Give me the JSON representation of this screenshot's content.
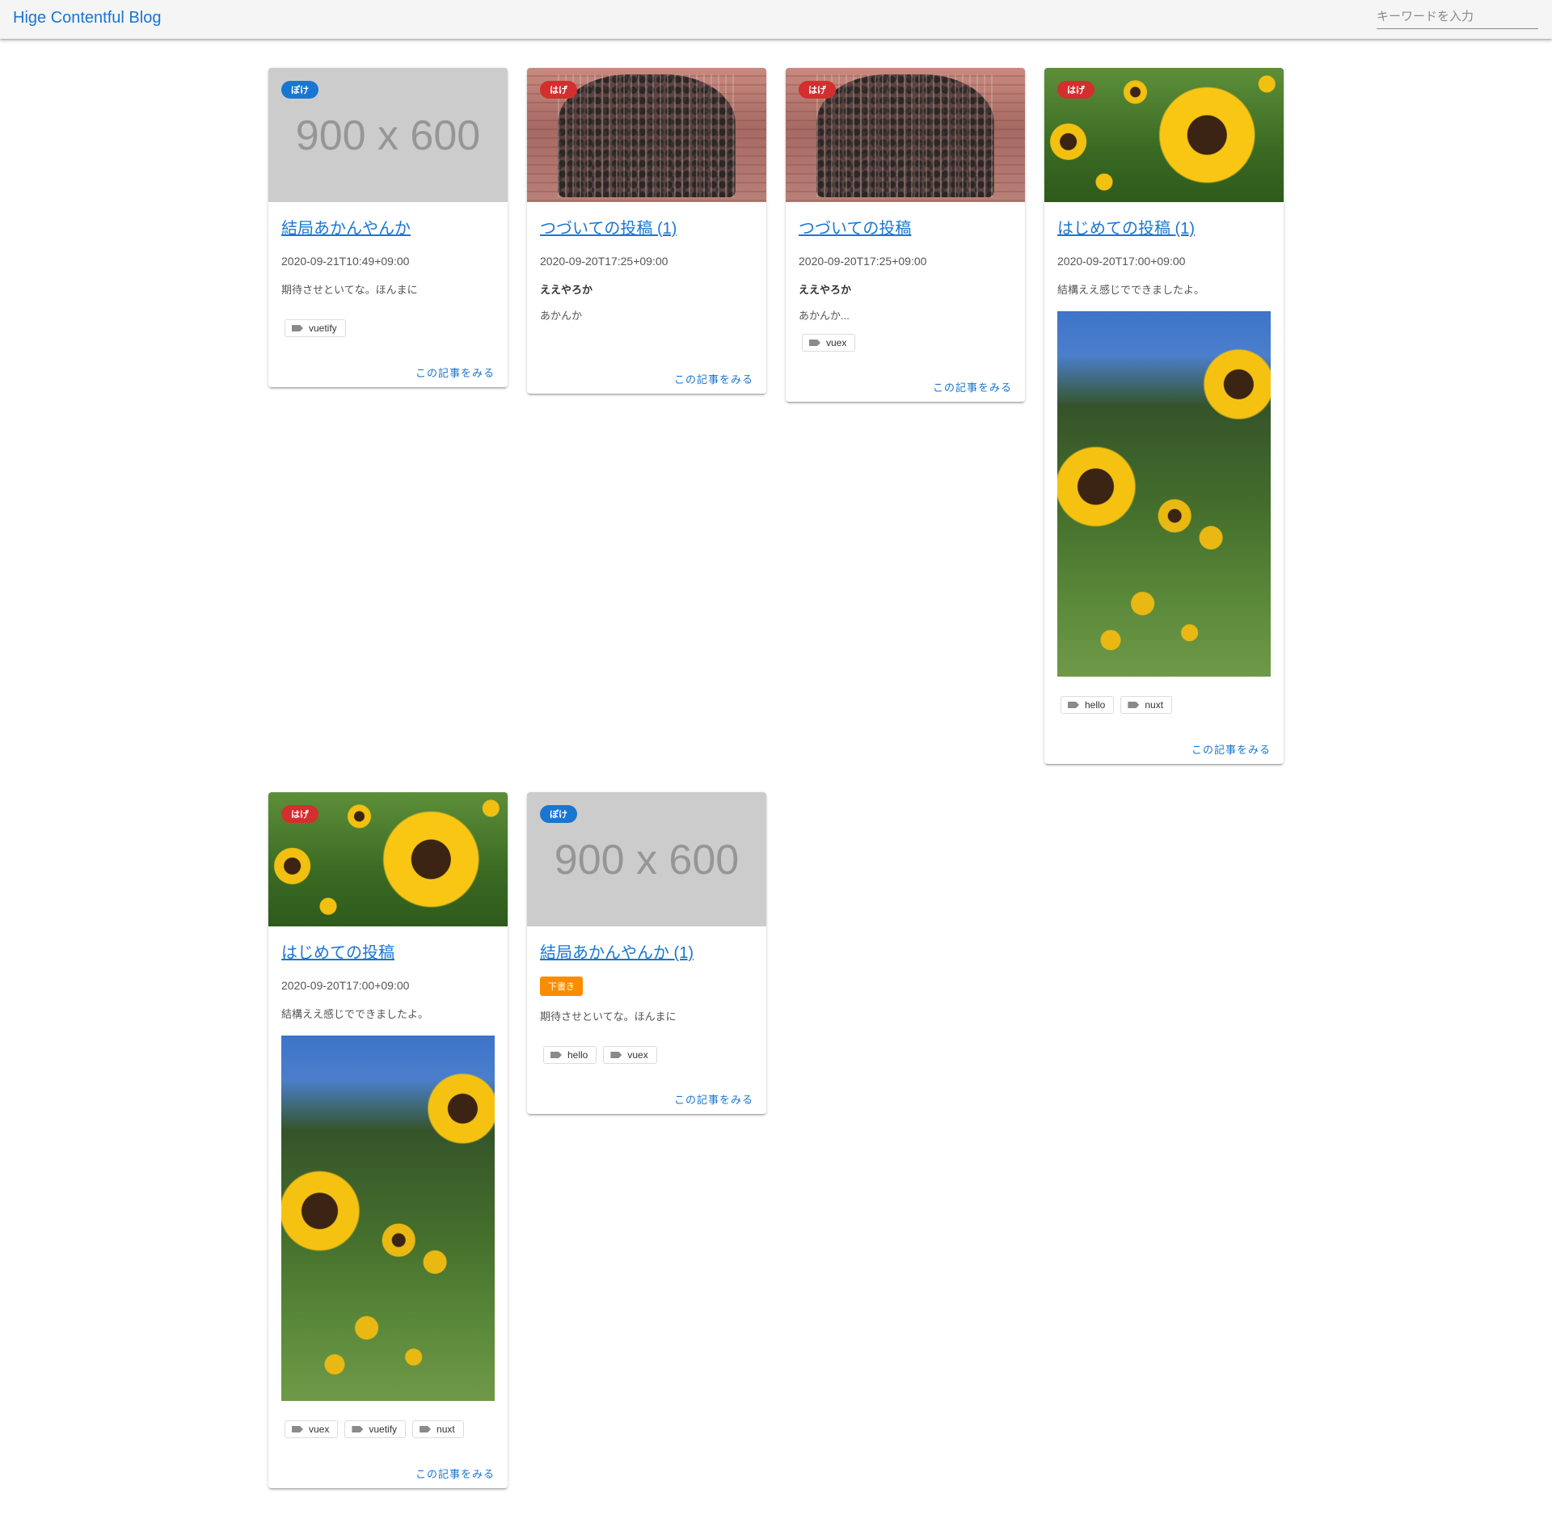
{
  "app": {
    "title": "Hige Contentful Blog"
  },
  "search": {
    "placeholder": "キーワードを入力"
  },
  "more_label": "この記事をみる",
  "colors": {
    "primary": "#1976d2",
    "error": "#d32f2f",
    "draft": "#fb8c00",
    "placeholder_bg": "#cccccc"
  },
  "posts": [
    {
      "category": "ぽけ",
      "category_color": "blue",
      "thumbnail_text": "900 x 600",
      "title": "結局あかんやんか",
      "date": "2020-09-21T10:49+09:00",
      "description": "期待させといてな。ほんまに",
      "tags": [
        "vuetify"
      ]
    },
    {
      "category": "はげ",
      "category_color": "red",
      "thumbnail": "crowd-photo",
      "title": "つづいての投稿 (1)",
      "date": "2020-09-20T17:25+09:00",
      "heading": "ええやろか",
      "body": "あかんか",
      "tags": []
    },
    {
      "category": "はげ",
      "category_color": "red",
      "thumbnail": "crowd-photo",
      "title": "つづいての投稿",
      "date": "2020-09-20T17:25+09:00",
      "heading": "ええやろか",
      "body": "あかんか...",
      "tags": [
        "vuex"
      ]
    },
    {
      "category": "はげ",
      "category_color": "red",
      "thumbnail": "sunflower-photo",
      "title": "はじめての投稿 (1)",
      "date": "2020-09-20T17:00+09:00",
      "description": "結構ええ感じでできましたよ。",
      "tags": [
        "hello",
        "nuxt"
      ]
    },
    {
      "category": "はげ",
      "category_color": "red",
      "thumbnail": "sunflower-photo",
      "title": "はじめての投稿",
      "date": "2020-09-20T17:00+09:00",
      "description": "結構ええ感じでできましたよ。",
      "tags": [
        "vuex",
        "vuetify",
        "nuxt"
      ]
    },
    {
      "category": "ぽけ",
      "category_color": "blue",
      "thumbnail_text": "900 x 600",
      "title": "結局あかんやんか (1)",
      "draft_label": "下書き",
      "description": "期待させといてな。ほんまに",
      "tags": [
        "hello",
        "vuex"
      ]
    }
  ]
}
